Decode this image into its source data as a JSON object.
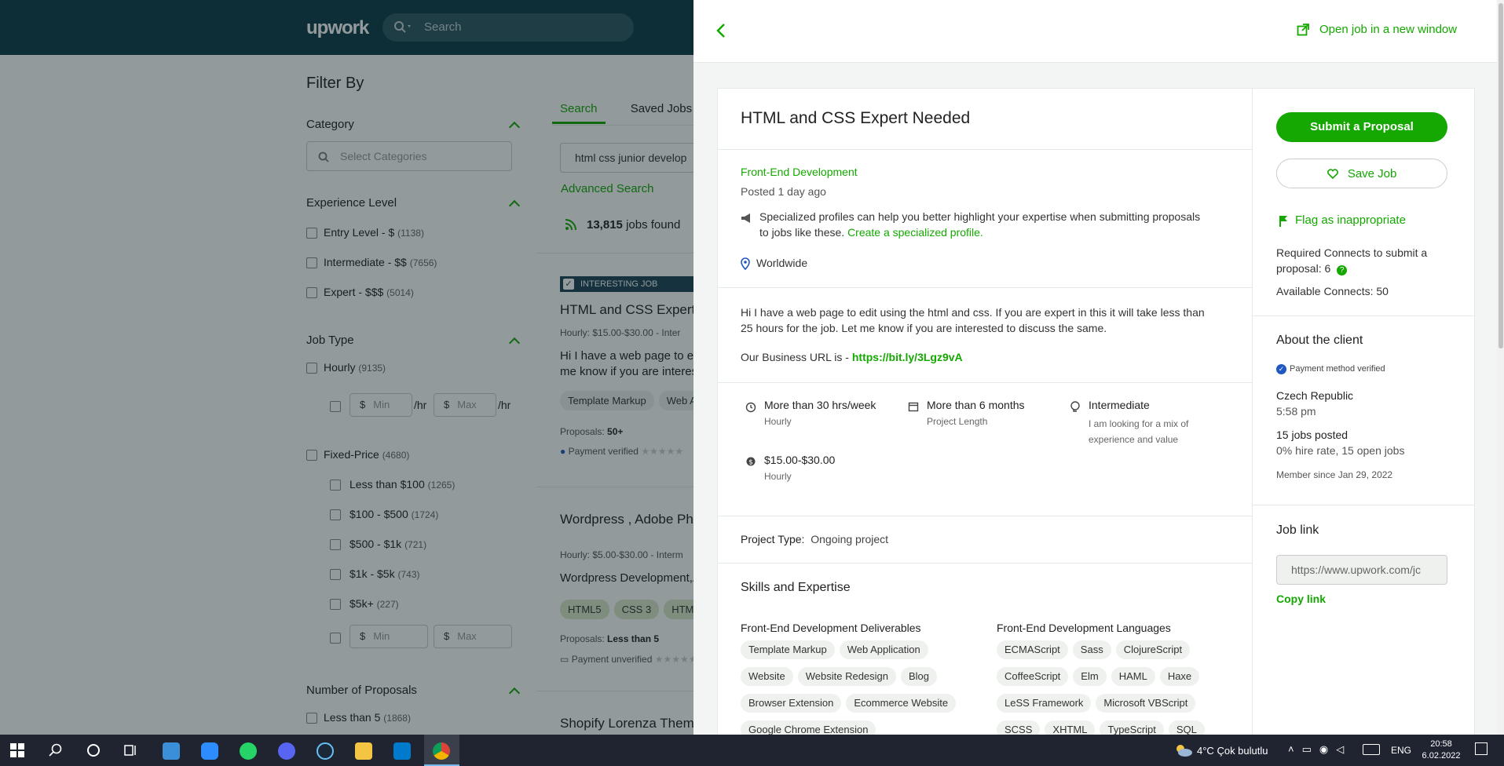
{
  "app": {
    "logo": "upwork",
    "search_placeholder": "Search"
  },
  "filter": {
    "title": "Filter By",
    "category": {
      "label": "Category",
      "placeholder": "Select Categories"
    },
    "experience": {
      "label": "Experience Level",
      "items": [
        {
          "label": "Entry Level - $",
          "count": "(1138)"
        },
        {
          "label": "Intermediate - $$",
          "count": "(7656)"
        },
        {
          "label": "Expert - $$$",
          "count": "(5014)"
        }
      ]
    },
    "job_type": {
      "label": "Job Type",
      "hourly": {
        "label": "Hourly",
        "count": "(9135)"
      },
      "min": "Min",
      "max": "Max",
      "per_hr": "/hr",
      "dollar": "$",
      "fixed": {
        "label": "Fixed-Price",
        "count": "(4680)"
      },
      "fixed_items": [
        {
          "label": "Less than $100",
          "count": "(1265)"
        },
        {
          "label": "$100 - $500",
          "count": "(1724)"
        },
        {
          "label": "$500 - $1k",
          "count": "(721)"
        },
        {
          "label": "$1k - $5k",
          "count": "(743)"
        },
        {
          "label": "$5k+",
          "count": "(227)"
        }
      ]
    },
    "proposals": {
      "label": "Number of Proposals",
      "first": {
        "label": "Less than 5",
        "count": "(1868)"
      }
    }
  },
  "search_results": {
    "tabs": [
      "Search",
      "Saved Jobs"
    ],
    "query": "html css junior develop",
    "advanced": "Advanced Search",
    "found_count": "13,815",
    "found_label": "jobs found",
    "jobs": [
      {
        "badge": "INTERESTING JOB",
        "title": "HTML and CSS Expert",
        "meta": "Hourly: $15.00-$30.00 - Inter",
        "desc1": "Hi I have a web page to edi",
        "desc2": "me know if you are interes",
        "skills": [
          "Template Markup",
          "Web A"
        ],
        "proposals_label": "Proposals:",
        "proposals": "50+",
        "payment": "Payment verified"
      },
      {
        "title": "Wordpress , Adobe Pho",
        "meta": "Hourly: $5.00-$30.00 - Interm",
        "desc1": "Wordpress Development,A",
        "skills": [
          "HTML5",
          "CSS 3",
          "HTML"
        ],
        "proposals_label": "Proposals:",
        "proposals": "Less than 5",
        "payment": "Payment unverified"
      },
      {
        "title": "Shopify Lorenza Them"
      }
    ]
  },
  "panel": {
    "open_window": "Open job in a new window",
    "job": {
      "title": "HTML and CSS Expert Needed",
      "category": "Front-End Development",
      "posted": "Posted 1 day ago",
      "specialized_text1": "Specialized profiles can help you better highlight your expertise when submitting proposals",
      "specialized_text2": "to jobs like these.",
      "specialized_link": "Create a specialized profile.",
      "location": "Worldwide",
      "desc1": "Hi I have a web page to edit using the html and css. If you are expert in this it will take less than",
      "desc2": "25 hours for the job. Let me know if you are interested to discuss the same.",
      "url_label": "Our Business URL is -",
      "url": "https://bit.ly/3Lgz9vA",
      "features": [
        {
          "title": "More than 30 hrs/week",
          "sub": "Hourly"
        },
        {
          "title": "More than 6 months",
          "sub": "Project Length"
        },
        {
          "title": "Intermediate",
          "sub": "I am looking for a mix of",
          "sub2": "experience and value"
        },
        {
          "title": "$15.00-$30.00",
          "sub": "Hourly"
        }
      ],
      "project_type_label": "Project Type:",
      "project_type": "Ongoing project",
      "skills_title": "Skills and Expertise",
      "deliverables_title": "Front-End Development Deliverables",
      "deliverables": [
        "Template Markup",
        "Web Application",
        "Website",
        "Website Redesign",
        "Blog",
        "Browser Extension",
        "Ecommerce Website",
        "Google Chrome Extension"
      ],
      "languages_title": "Front-End Development Languages",
      "languages": [
        "ECMAScript",
        "Sass",
        "ClojureScript",
        "CoffeeScript",
        "Elm",
        "HAML",
        "Haxe",
        "LeSS Framework",
        "Microsoft VBScript",
        "SCSS",
        "XHTML",
        "TypeScript",
        "SQL"
      ]
    },
    "side": {
      "submit": "Submit a Proposal",
      "save": "Save Job",
      "flag": "Flag as inappropriate",
      "connects_req1": "Required Connects to submit a",
      "connects_req2": "proposal: 6",
      "connects_avail": "Available Connects: 50",
      "about_title": "About the client",
      "payment": "Payment method verified",
      "country": "Czech Republic",
      "time": "5:58 pm",
      "jobs_posted": "15 jobs posted",
      "hire_rate": "0% hire rate, 15 open jobs",
      "member_since": "Member since Jan 29, 2022",
      "job_link_title": "Job link",
      "job_link": "https://www.upwork.com/jc",
      "copy_link": "Copy link"
    }
  },
  "taskbar": {
    "weather_temp": "4°C",
    "weather_text": "Çok bulutlu",
    "lang": "ENG",
    "time": "20:58",
    "date": "6.02.2022"
  },
  "colors": {
    "accent": "#14a800",
    "topbar": "#0d3b46",
    "taskbar": "#1f2430"
  }
}
